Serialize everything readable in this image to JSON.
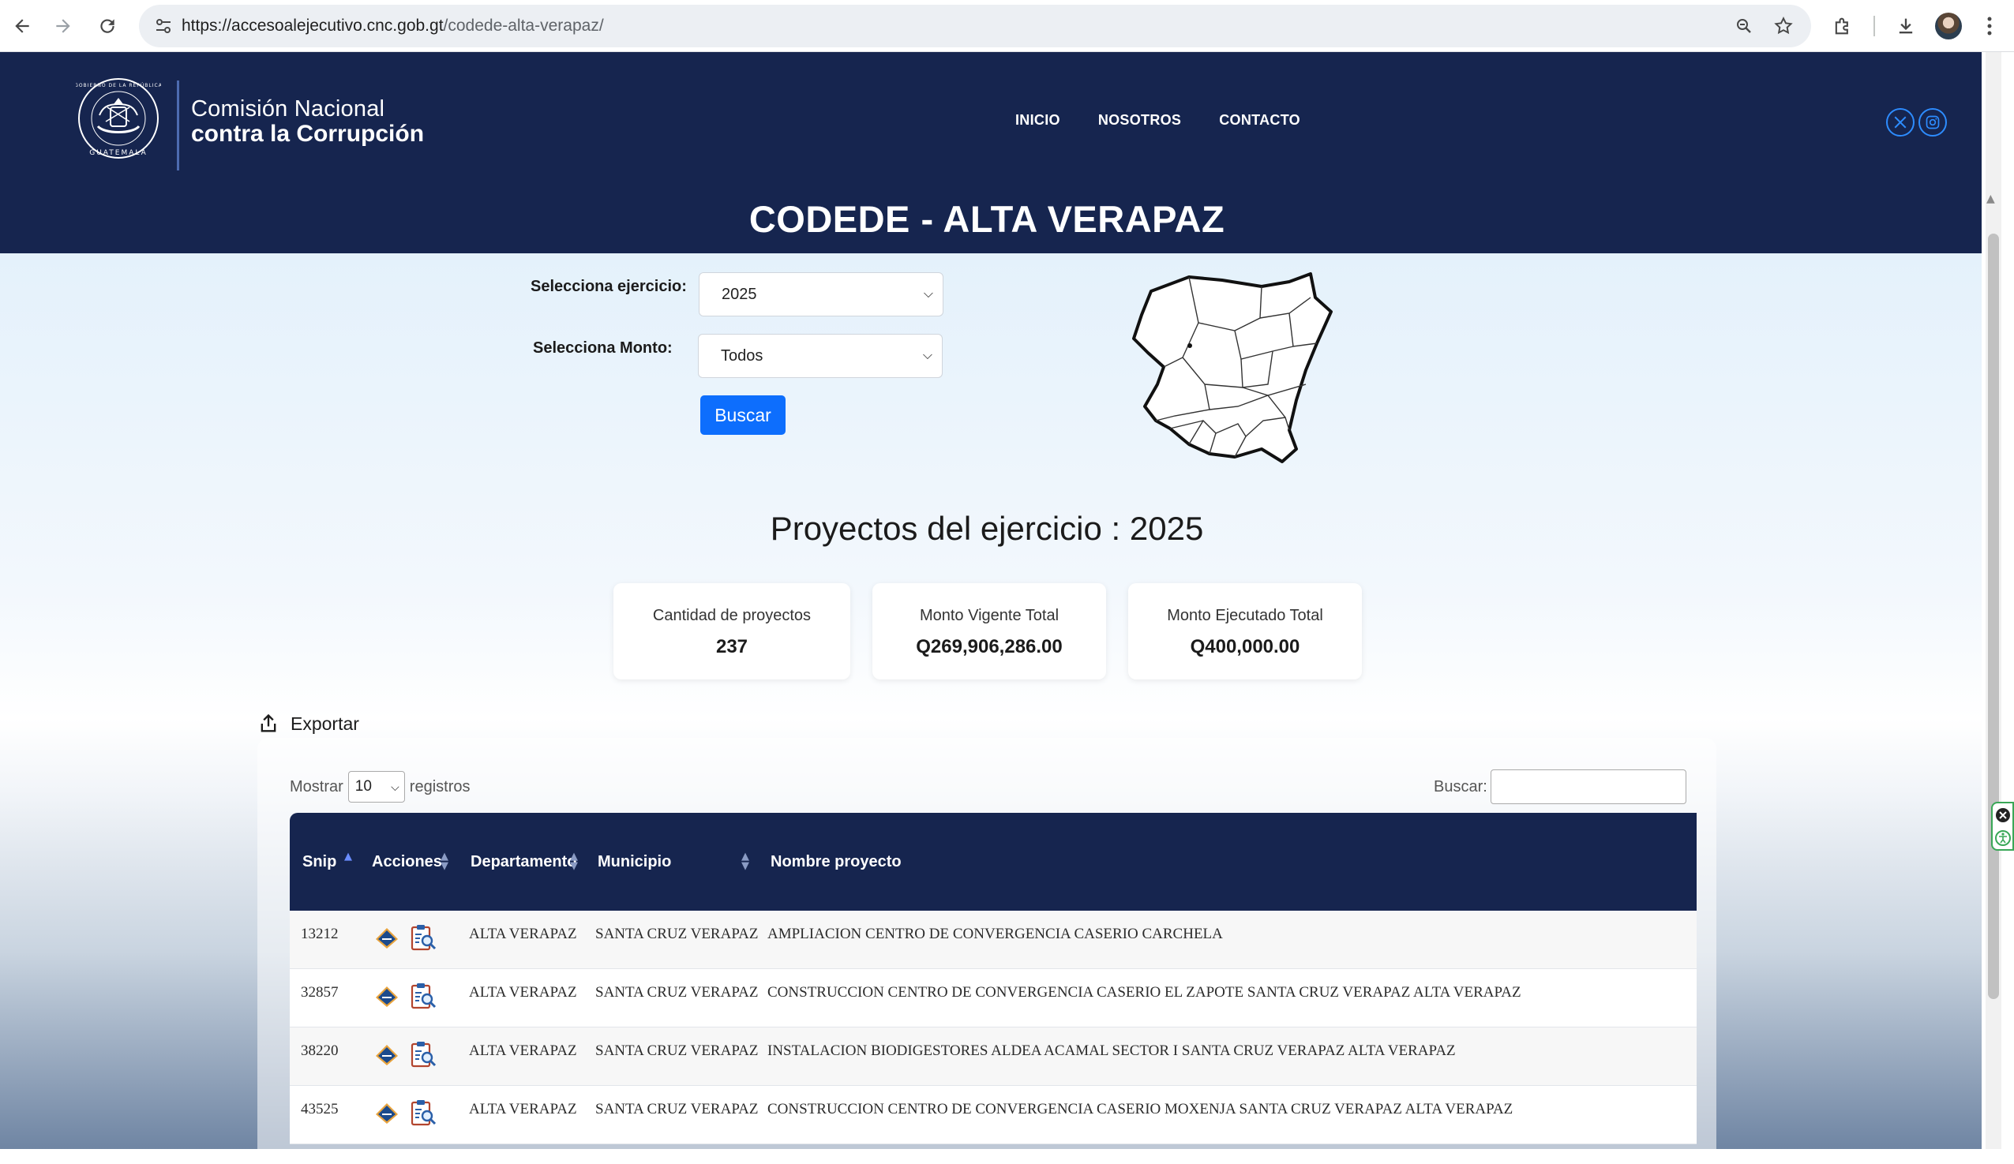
{
  "browser": {
    "url_host": "https://accesoalejecutivo.cnc.gob.gt",
    "url_path": "/codede-alta-verapaz/"
  },
  "header": {
    "logo_line1": "Comisión Nacional",
    "logo_line2": "contra la Corrupción",
    "seal_text": "GOBIERNO DE LA REPÚBLICA · GUATEMALA",
    "nav": [
      "INICIO",
      "NOSOTROS",
      "CONTACTO"
    ],
    "title": "CODEDE - ALTA VERAPAZ"
  },
  "filters": {
    "ejercicio_label": "Selecciona ejercicio:",
    "ejercicio_value": "2025",
    "monto_label": "Selecciona Monto:",
    "monto_value": "Todos",
    "search_button": "Buscar"
  },
  "summary": {
    "title": "Proyectos del ejercicio : 2025",
    "cards": [
      {
        "label": "Cantidad de proyectos",
        "value": "237"
      },
      {
        "label": "Monto Vigente Total",
        "value": "Q269,906,286.00"
      },
      {
        "label": "Monto Ejecutado Total",
        "value": "Q400,000.00"
      }
    ]
  },
  "table": {
    "export_label": "Exportar",
    "show_label": "Mostrar",
    "show_value": "10",
    "records_label": "registros",
    "search_label": "Buscar:",
    "columns": [
      "Snip",
      "Acciones",
      "Departamento",
      "Municipio",
      "Nombre proyecto"
    ],
    "rows": [
      {
        "snip": "13212",
        "departamento": "ALTA VERAPAZ",
        "municipio": "SANTA CRUZ VERAPAZ",
        "nombre": "AMPLIACION CENTRO DE CONVERGENCIA CASERIO CARCHELA"
      },
      {
        "snip": "32857",
        "departamento": "ALTA VERAPAZ",
        "municipio": "SANTA CRUZ VERAPAZ",
        "nombre": "CONSTRUCCION CENTRO DE CONVERGENCIA CASERIO EL ZAPOTE SANTA CRUZ VERAPAZ ALTA VERAPAZ"
      },
      {
        "snip": "38220",
        "departamento": "ALTA VERAPAZ",
        "municipio": "SANTA CRUZ VERAPAZ",
        "nombre": "INSTALACION BIODIGESTORES ALDEA ACAMAL SECTOR I SANTA CRUZ VERAPAZ ALTA VERAPAZ"
      },
      {
        "snip": "43525",
        "departamento": "ALTA VERAPAZ",
        "municipio": "SANTA CRUZ VERAPAZ",
        "nombre": "CONSTRUCCION CENTRO DE CONVERGENCIA CASERIO MOXENJA SANTA CRUZ VERAPAZ ALTA VERAPAZ"
      }
    ]
  },
  "colors": {
    "brand_navy": "#16254f",
    "primary_button": "#0d6efd",
    "social_blue": "#2d8cff"
  },
  "icons": {
    "back": "arrow-left-icon",
    "forward": "arrow-right-icon",
    "reload": "reload-icon",
    "site_info": "tune-icon",
    "zoom": "zoom-icon",
    "bookmark": "star-icon",
    "extensions": "puzzle-icon",
    "download": "download-icon",
    "menu": "kebab-menu-icon",
    "social_x": "x-logo-icon",
    "social_instagram": "instagram-icon",
    "export": "share-export-icon",
    "row_action_1": "diamond-sign-icon",
    "row_action_2": "clipboard-search-icon"
  }
}
